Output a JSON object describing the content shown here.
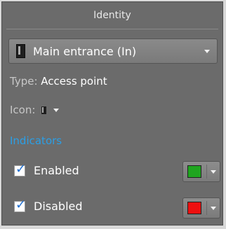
{
  "panel": {
    "title": "Identity"
  },
  "selector": {
    "value": "Main entrance (In)",
    "icon": "door-icon"
  },
  "type_row": {
    "key": "Type:",
    "value": "Access point"
  },
  "icon_row": {
    "key": "Icon:",
    "icon": "door-icon"
  },
  "section": {
    "heading": "Indicators"
  },
  "indicators": [
    {
      "label": "Enabled",
      "checked": true,
      "color": "#1fa51f"
    },
    {
      "label": "Disabled",
      "checked": true,
      "color": "#ee1010"
    }
  ],
  "colors": {
    "panel_bg": "#6b6b6b",
    "accent": "#2b9fe6",
    "check": "#1f6fd1"
  }
}
